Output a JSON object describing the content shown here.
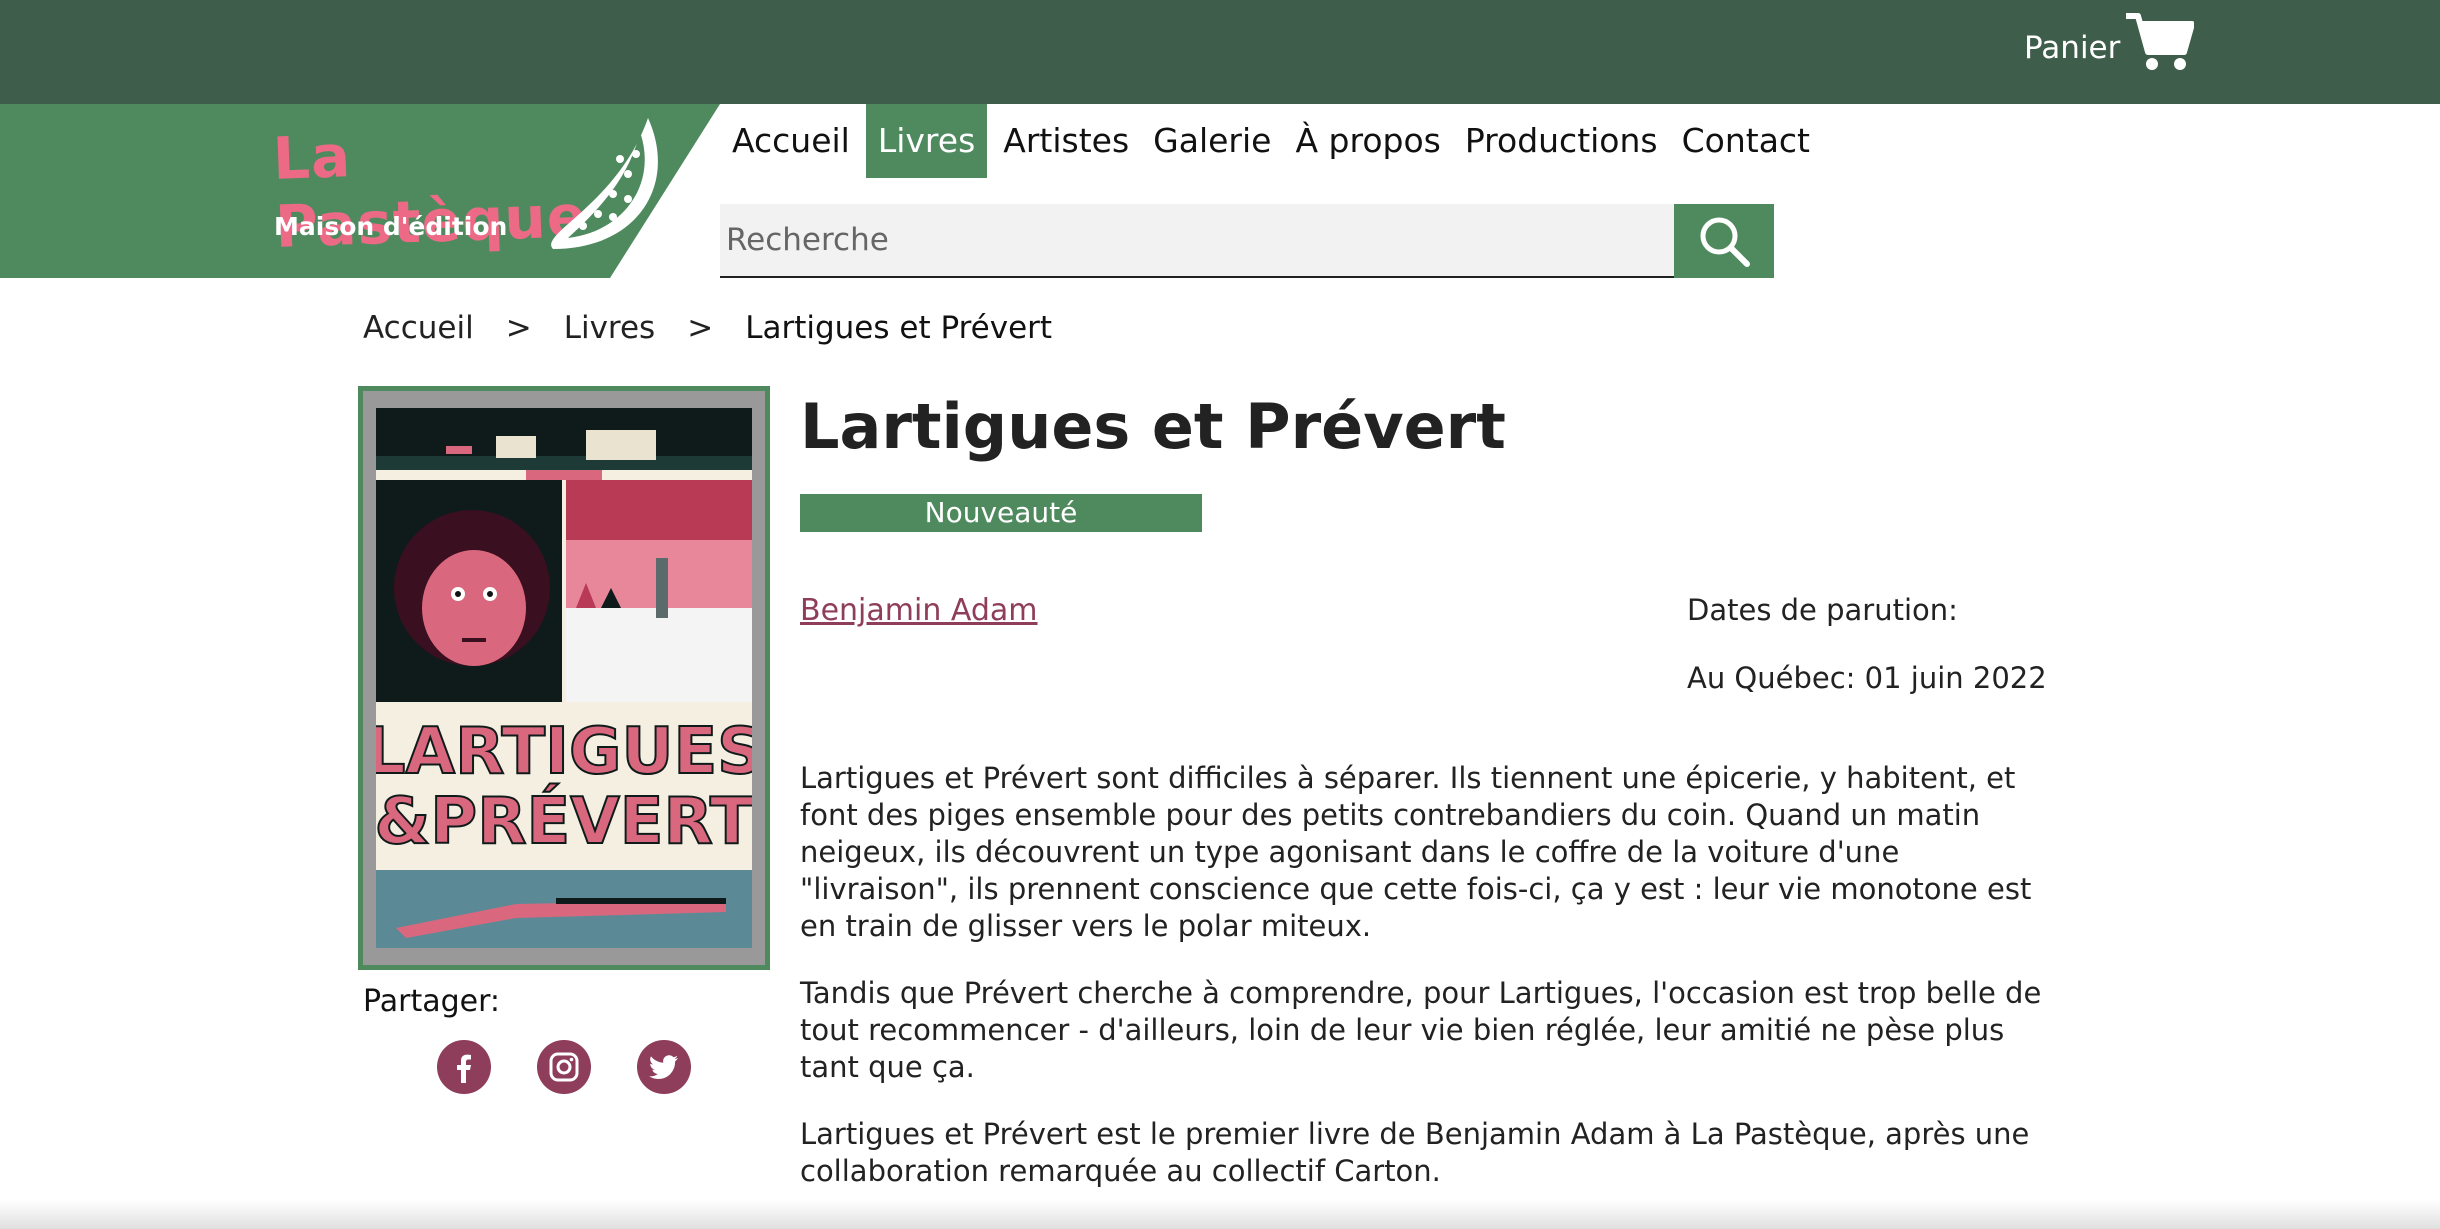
{
  "topbar": {
    "cart_label": "Panier",
    "cart_icon": "cart-icon"
  },
  "logo": {
    "title": "La Pastèque",
    "subtitle": "Maison d'édition"
  },
  "nav": {
    "items": [
      {
        "label": "Accueil",
        "active": false
      },
      {
        "label": "Livres",
        "active": true
      },
      {
        "label": "Artistes",
        "active": false
      },
      {
        "label": "Galerie",
        "active": false
      },
      {
        "label": "À propos",
        "active": false
      },
      {
        "label": "Productions",
        "active": false
      },
      {
        "label": "Contact",
        "active": false
      }
    ]
  },
  "search": {
    "placeholder": "Recherche",
    "value": "",
    "icon": "search-icon"
  },
  "breadcrumb": {
    "items": [
      "Accueil",
      "Livres",
      "Lartigues et Prévert"
    ],
    "separator": ">"
  },
  "book": {
    "title": "Lartigues et Prévert",
    "badge": "Nouveauté",
    "author": "Benjamin Adam",
    "dates_label": "Dates de parution:",
    "date_quebec": "Au Québec: 01 juin 2022",
    "cover_alt": "Lartigues et Prévert cover",
    "description": [
      "Lartigues et Prévert sont difficiles à séparer. Ils tiennent une épicerie, y habitent, et font des piges ensemble pour des petits contrebandiers du coin. Quand un matin neigeux, ils découvrent un type agonisant dans le coffre de la voiture d'une \"livraison\", ils prennent conscience que cette fois-ci, ça y est : leur vie monotone est en train de glisser vers le polar miteux.",
      "Tandis que Prévert cherche à comprendre, pour Lartigues, l'occasion est trop belle de tout recommencer - d'ailleurs, loin de leur vie bien réglée, leur amitié ne pèse plus tant que ça.",
      "Lartigues et Prévert est le premier livre de Benjamin Adam à La Pastèque, après une collaboration remarquée au collectif Carton."
    ]
  },
  "share": {
    "label": "Partager:",
    "icons": [
      "facebook-icon",
      "instagram-icon",
      "twitter-icon"
    ]
  },
  "colors": {
    "topbar": "#3e5d4a",
    "brand_green": "#4f8a5f",
    "accent_pink": "#8e3d5a",
    "logo_pink": "#ec6a86"
  }
}
